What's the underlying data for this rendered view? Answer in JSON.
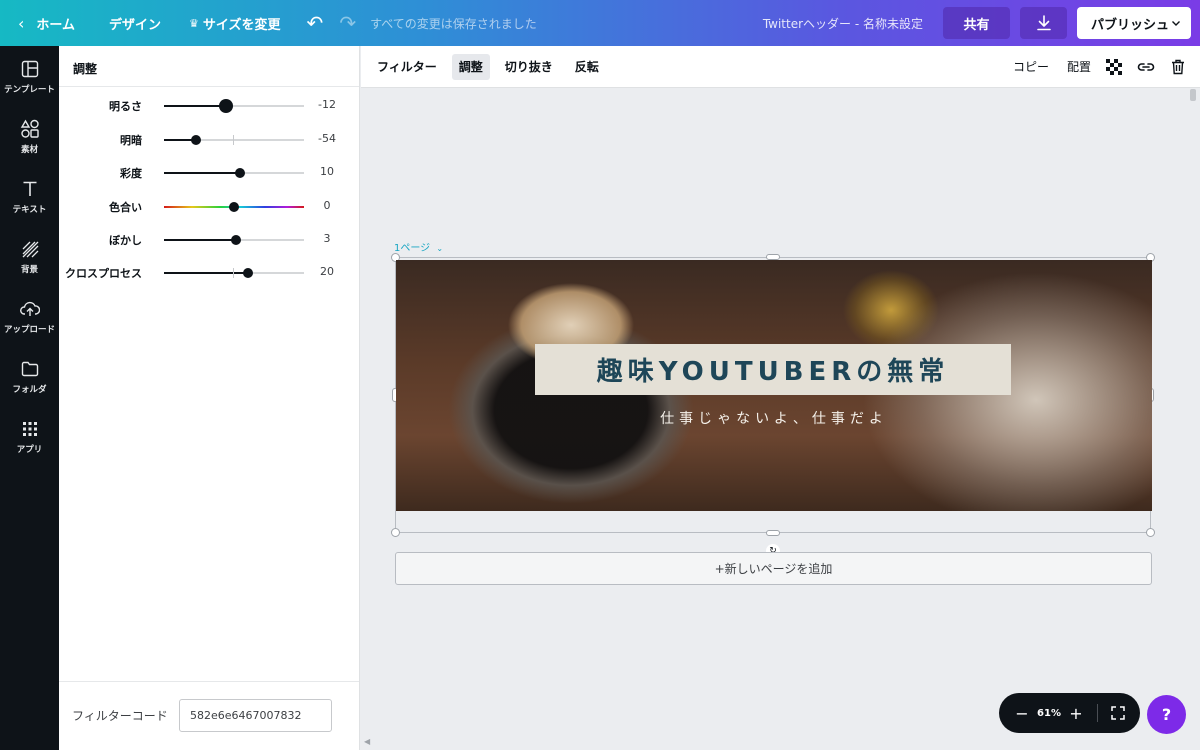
{
  "topbar": {
    "home_label": "ホーム",
    "design_label": "デザイン",
    "resize_label": "サイズを変更",
    "saved_status": "すべての変更は保存されました",
    "doc_title": "Twitterヘッダー - 名称未設定",
    "share_label": "共有",
    "publish_label": "パブリッシュ"
  },
  "sidebar": {
    "items": [
      {
        "label": "テンプレート",
        "icon": "template-icon"
      },
      {
        "label": "素材",
        "icon": "elements-icon"
      },
      {
        "label": "テキスト",
        "icon": "text-icon"
      },
      {
        "label": "背景",
        "icon": "background-icon"
      },
      {
        "label": "アップロード",
        "icon": "upload-icon"
      },
      {
        "label": "フォルダ",
        "icon": "folder-icon"
      },
      {
        "label": "アプリ",
        "icon": "apps-icon"
      }
    ]
  },
  "panel": {
    "title": "調整",
    "sliders": [
      {
        "label": "明るさ",
        "value": "-12"
      },
      {
        "label": "明暗",
        "value": "-54"
      },
      {
        "label": "彩度",
        "value": "10"
      },
      {
        "label": "色合い",
        "value": "0"
      },
      {
        "label": "ぼかし",
        "value": "3"
      },
      {
        "label": "クロスプロセス",
        "value": "20"
      }
    ],
    "filter_code_label": "フィルターコード",
    "filter_code_value": "582e6e6467007832"
  },
  "toolbar": {
    "filter_label": "フィルター",
    "adjust_label": "調整",
    "crop_label": "切り抜き",
    "flip_label": "反転",
    "copy_label": "コピー",
    "arrange_label": "配置"
  },
  "canvas": {
    "page_label": "1ページ",
    "design_title": "趣味YOUTUBERの無常",
    "design_subtitle": "仕事じゃないよ、仕事だよ",
    "add_page_label": "+新しいページを追加",
    "zoom": "61%",
    "help_label": "?"
  },
  "colors": {
    "accent_gradient_start": "#16b9c4",
    "accent_gradient_end": "#7a3ce6",
    "help_button": "#7d2ae8",
    "title_text": "#1e4658"
  }
}
